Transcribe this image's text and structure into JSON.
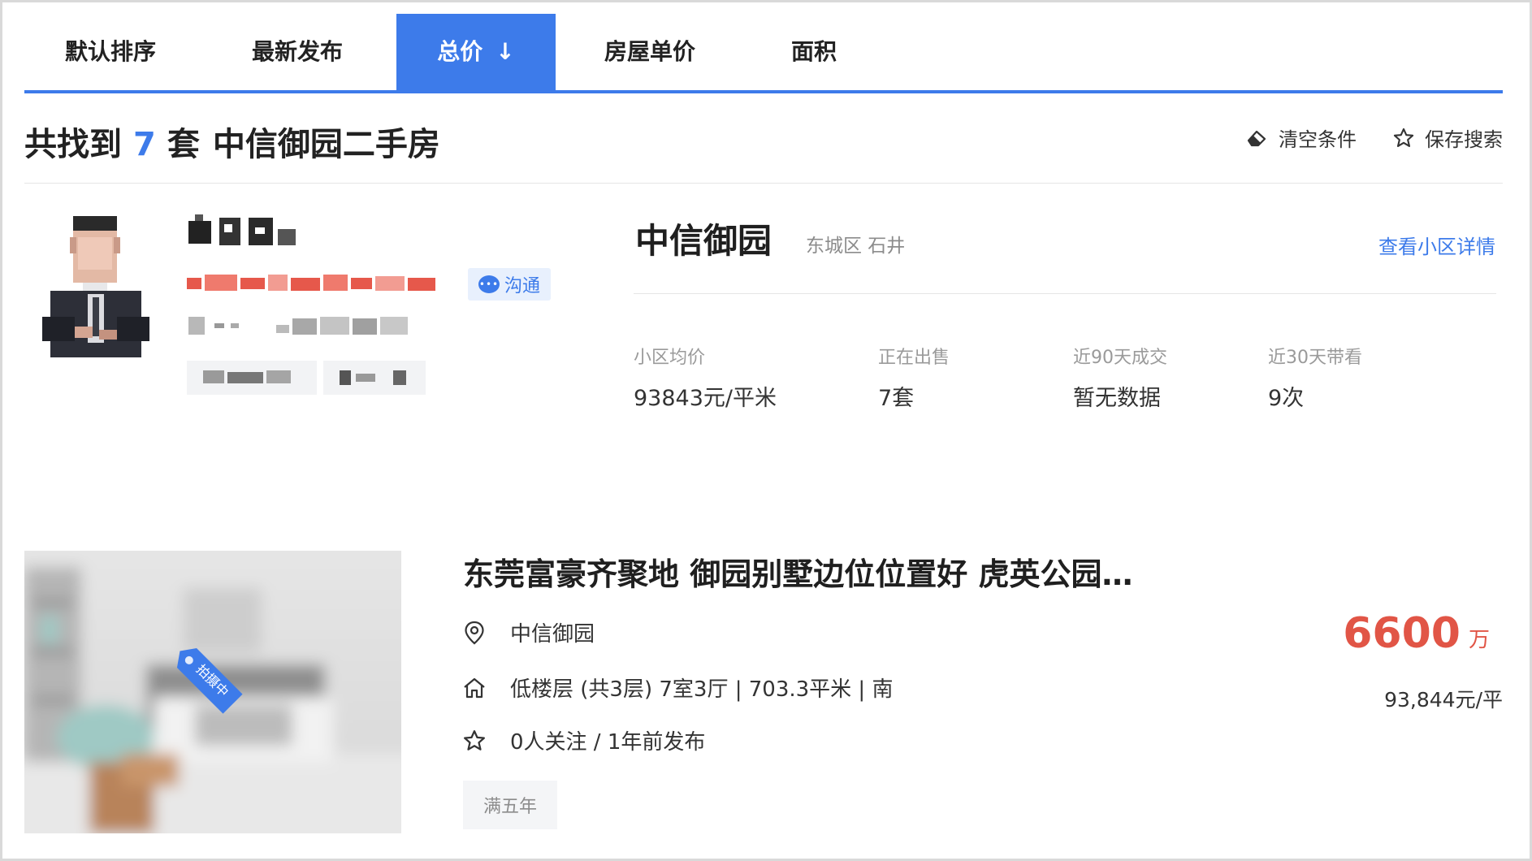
{
  "tabs": [
    {
      "label": "默认排序"
    },
    {
      "label": "最新发布"
    },
    {
      "label": "总价",
      "arrow": "↓"
    },
    {
      "label": "房屋单价"
    },
    {
      "label": "面积"
    }
  ],
  "summary": {
    "prefix": "共找到",
    "count": "7",
    "suffix": "套",
    "name": "中信御园二手房"
  },
  "actions": {
    "clear": "清空条件",
    "save": "保存搜索"
  },
  "agent": {
    "chat_label": "沟通"
  },
  "community": {
    "title": "中信御园",
    "district": "东城区 石井",
    "link": "查看小区详情",
    "stats": [
      {
        "label": "小区均价",
        "value": "93843元/平米"
      },
      {
        "label": "正在出售",
        "value": "7套"
      },
      {
        "label": "近90天成交",
        "value": "暂无数据"
      },
      {
        "label": "近30天带看",
        "value": "9次"
      }
    ]
  },
  "listing": {
    "title": "东莞富豪齐聚地 御园别墅边位位置好 虎英公园…",
    "community": "中信御园",
    "details": "低楼层 (共3层) 7室3厅 | 703.3平米 | 南",
    "follow": "0人关注 / 1年前发布",
    "price": "6600",
    "price_unit": "万",
    "unit_price": "93,844元/平",
    "badge": "满五年",
    "photo_tag": "拍摄中"
  },
  "colors": {
    "accent": "#3d7bea",
    "price": "#e15546"
  }
}
